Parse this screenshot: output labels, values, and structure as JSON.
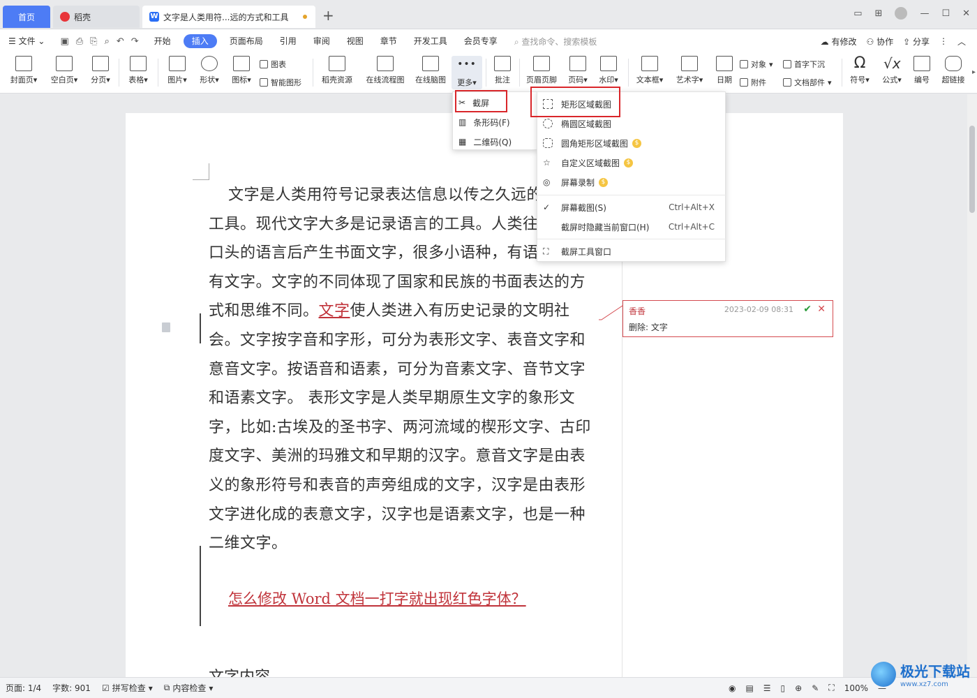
{
  "tabs": {
    "home": "首页",
    "daoke": "稻壳",
    "doc": "文字是人类用符...远的方式和工具"
  },
  "menu": {
    "file": "文件",
    "items": [
      "开始",
      "插入",
      "页面布局",
      "引用",
      "审阅",
      "视图",
      "章节",
      "开发工具",
      "会员专享"
    ],
    "active": "插入",
    "search": "查找命令、搜索模板",
    "right": [
      "有修改",
      "协作",
      "分享"
    ]
  },
  "ribbon": {
    "cover": "封面页",
    "blank": "空白页",
    "pagebreak": "分页",
    "table": "表格",
    "picture": "图片",
    "shape": "形状",
    "icon": "图标",
    "chart": "图表",
    "smartart": "智能图形",
    "daoke_res": "稻壳资源",
    "flow": "在线流程图",
    "mind": "在线脑图",
    "more": "更多",
    "comment": "批注",
    "header_footer": "页眉页脚",
    "page_num": "页码",
    "watermark": "水印",
    "textbox": "文本框",
    "wordart": "艺术字",
    "date": "日期",
    "object": "对象",
    "attach": "附件",
    "dropcap": "首字下沉",
    "docpart": "文档部件",
    "symbol": "符号",
    "formula": "公式",
    "number": "编号",
    "hyperlink": "超链接"
  },
  "more_menu": {
    "screenshot": "截屏",
    "barcode": "条形码(F)",
    "qrcode": "二维码(Q)"
  },
  "screenshot_menu": {
    "rect": "矩形区域截图",
    "ellipse": "椭圆区域截图",
    "rounded": "圆角矩形区域截图",
    "custom": "自定义区域截图",
    "record": "屏幕录制",
    "screen": "屏幕截图(S)",
    "screen_sc": "Ctrl+Alt+X",
    "hide": "截屏时隐藏当前窗口(H)",
    "hide_sc": "Ctrl+Alt+C",
    "tool": "截屏工具窗口"
  },
  "doc": {
    "p1": "文字是人类用符号记录表达信息以传之久远的方式和工具。现代文字大多是记录语言的工具。人类往往先有口头的语言后产生书面文字，很多小语种，有语言但没有文字。文字的不同体现了国家和民族的书面表达的方式和思维不同。",
    "deleted": "文字",
    "p2": "使人类进入有历史记录的文明社会。文字按字音和字形，可分为表形文字、表音文字和意音文字。按语音和语素，可分为音素文字、音节文字和语素文字。 表形文字是人类早期原生文字的象形文字，比如:古埃及的圣书字、两河流域的楔形文字、古印度文字、美洲的玛雅文和早期的汉字。意音文字是由表义的象形符号和表音的声旁组成的文字，汉字是由表形文字进化成的表意文字，汉字也是语素文字，也是一种二维文字。",
    "title2": "怎么修改 Word 文档一打字就出现红色字体？",
    "heading": "文字内容"
  },
  "comment": {
    "author": "香香",
    "time": "2023-02-09 08:31",
    "text": "删除: 文字"
  },
  "status": {
    "page": "页面: 1/4",
    "words": "字数: 901",
    "spell": "拼写检查",
    "content": "内容检查",
    "zoom": "100%"
  },
  "watermark": {
    "title": "极光下载站",
    "sub": "www.xz7.com"
  },
  "colors": {
    "accent": "#4d7cf5",
    "revision": "#c0333a",
    "highlight": "#d9262a"
  }
}
